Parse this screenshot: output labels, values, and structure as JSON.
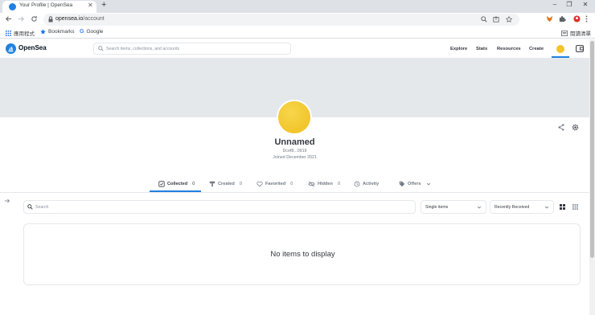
{
  "browser": {
    "tab_title": "Your Profile | OpenSea",
    "new_tab": "+",
    "win_min": "–",
    "win_max": "❐",
    "win_close": "✕",
    "tab_close": "✕",
    "url_host": "opensea.io",
    "url_path": "/account",
    "bookmarks": [
      {
        "label": "應用程式",
        "icon": "apps-grid-icon"
      },
      {
        "label": "Bookmarks",
        "icon": "star-icon"
      },
      {
        "label": "Google",
        "icon": "google-icon"
      }
    ],
    "reading_list": "閱讀清單"
  },
  "header": {
    "brand": "OpenSea",
    "search_placeholder": "Search items, collections, and accounts",
    "nav": [
      "Explore",
      "Stats",
      "Resources",
      "Create"
    ]
  },
  "profile": {
    "name": "Unnamed",
    "address": "Dcef8...0919",
    "joined": "Joined December 2021"
  },
  "tabs": [
    {
      "label": "Collected",
      "count": "0",
      "icon": "collected-icon",
      "active": true
    },
    {
      "label": "Created",
      "count": "0",
      "icon": "brush-icon"
    },
    {
      "label": "Favorited",
      "count": "0",
      "icon": "heart-icon"
    },
    {
      "label": "Hidden",
      "count": "0",
      "icon": "eye-off-icon"
    },
    {
      "label": "Activity",
      "count": "",
      "icon": "history-icon"
    },
    {
      "label": "Offers",
      "count": "",
      "icon": "tag-icon"
    }
  ],
  "filters": {
    "search_placeholder": "Search",
    "item_type": "Single items",
    "sort": "Recently Received"
  },
  "empty_message": "No items to display",
  "colors": {
    "accent": "#2081e2",
    "avatar": "#f5c32b",
    "banner": "#e5e8eb"
  }
}
